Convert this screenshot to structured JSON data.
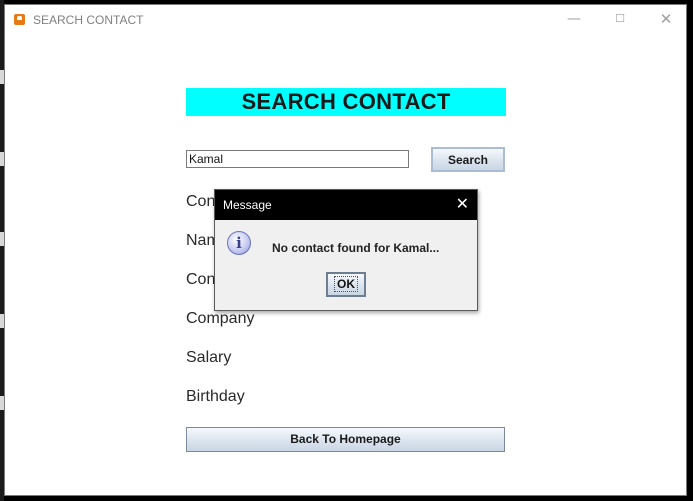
{
  "window": {
    "title": "SEARCH CONTACT",
    "min_glyph": "—",
    "max_glyph": "☐",
    "close_glyph": "✕"
  },
  "header": {
    "title": "SEARCH CONTACT",
    "background": "#00ffff"
  },
  "search": {
    "input_value": "Kamal",
    "button_label": "Search"
  },
  "fields": {
    "contact_id": "Con",
    "name": "Nam",
    "contact_no": "Con",
    "company": "Company",
    "salary": "Salary",
    "birthday": "Birthday"
  },
  "back_button_label": "Back To Homepage",
  "dialog": {
    "title": "Message",
    "close_glyph": "✕",
    "icon_glyph": "i",
    "message": "No contact found for Kamal...",
    "ok_label": "OK"
  }
}
